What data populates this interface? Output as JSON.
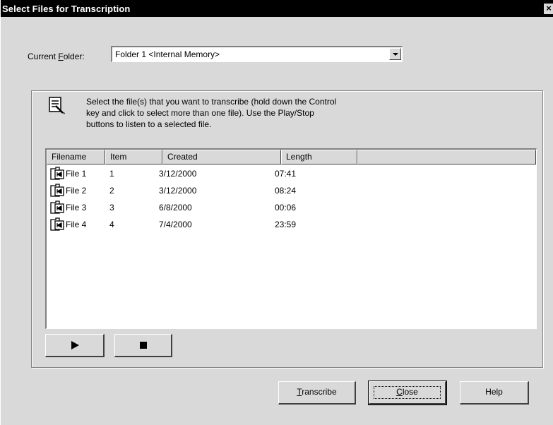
{
  "window": {
    "title": "Select Files for Transcription",
    "close_glyph": "×"
  },
  "folder": {
    "label_prefix": "Current ",
    "label_accel": "F",
    "label_suffix": "older:",
    "selected": "Folder 1  <Internal Memory>"
  },
  "instructions": {
    "icon": "document-pen-icon",
    "lines": [
      "Select the file(s) that you want to transcribe (hold down the Control",
      "key and click to select more than one file). Use the Play/Stop",
      "buttons to listen to a selected file."
    ]
  },
  "file_list": {
    "columns": [
      "Filename",
      "Item",
      "Created",
      "Length",
      ""
    ],
    "rows": [
      {
        "filename": "File 1",
        "item": "1",
        "created": "3/12/2000",
        "length": "07:41"
      },
      {
        "filename": "File 2",
        "item": "2",
        "created": "3/12/2000",
        "length": "08:24"
      },
      {
        "filename": "File 3",
        "item": "3",
        "created": "6/8/2000",
        "length": "00:06"
      },
      {
        "filename": "File 4",
        "item": "4",
        "created": "7/4/2000",
        "length": "23:59"
      }
    ]
  },
  "transport": {
    "play_icon": "play-icon",
    "stop_icon": "stop-icon"
  },
  "buttons": {
    "transcribe": {
      "accel": "T",
      "rest": "ranscribe"
    },
    "close": {
      "accel": "C",
      "rest": "lose"
    },
    "help": {
      "label": "Help"
    }
  }
}
